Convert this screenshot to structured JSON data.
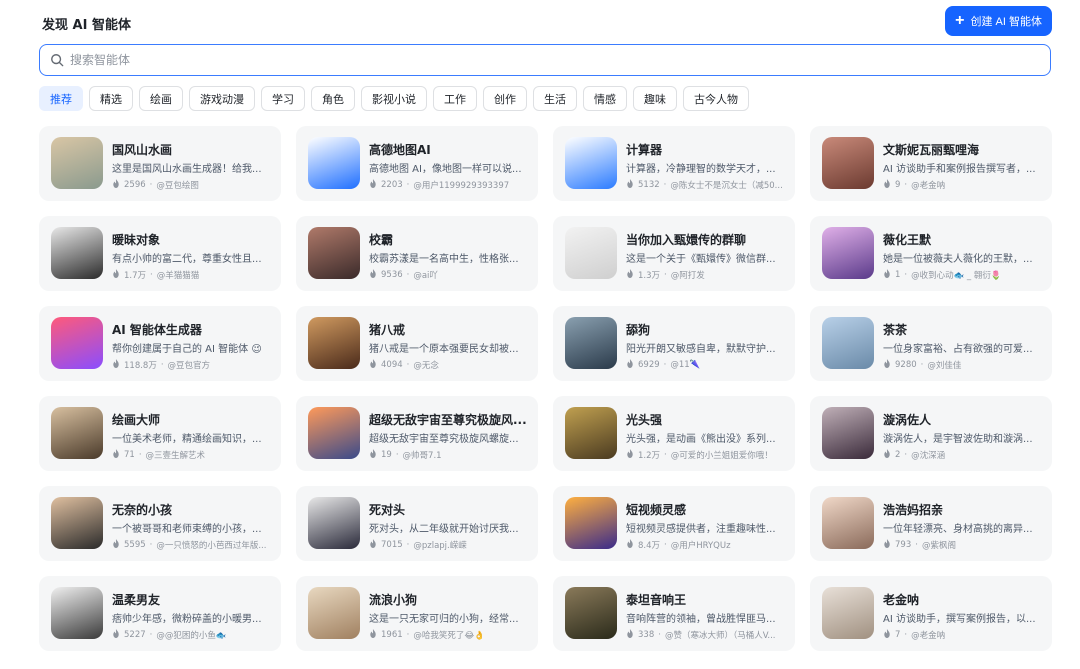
{
  "header": {
    "title": "发现 AI 智能体",
    "create_label": "创建 AI 智能体"
  },
  "search": {
    "placeholder": "搜索智能体"
  },
  "tabs": [
    {
      "label": "推荐",
      "active": true
    },
    {
      "label": "精选"
    },
    {
      "label": "绘画"
    },
    {
      "label": "游戏动漫"
    },
    {
      "label": "学习"
    },
    {
      "label": "角色"
    },
    {
      "label": "影视小说"
    },
    {
      "label": "工作"
    },
    {
      "label": "创作"
    },
    {
      "label": "生活"
    },
    {
      "label": "情感"
    },
    {
      "label": "趣味"
    },
    {
      "label": "古今人物"
    }
  ],
  "agents": [
    {
      "name": "国风山水画",
      "desc": "这里是国风山水画生成器！给我...",
      "count": "2596",
      "author": "@豆包绘图",
      "colors": [
        "#d9c6a5",
        "#8a9a8e"
      ]
    },
    {
      "name": "高德地图AI",
      "desc": "高德地图 AI，像地图一样可以说...",
      "count": "2203",
      "author": "@用户1199929393397",
      "colors": [
        "#ffffff",
        "#1f6fff"
      ]
    },
    {
      "name": "计算器",
      "desc": "计算器，冷静理智的数学天才，...",
      "count": "5132",
      "author": "@陈女士不是沉女士（减50...",
      "colors": [
        "#ffffff",
        "#2b7bff"
      ]
    },
    {
      "name": "文斯妮瓦丽甄哩海",
      "desc": "AI 访谈助手和案例报告撰写者，...",
      "count": "9",
      "author": "@老金呐",
      "colors": [
        "#c98a7a",
        "#6b3a30"
      ]
    },
    {
      "name": "暖昧对象",
      "desc": "有点小帅的富二代，尊重女性且...",
      "count": "1.7万",
      "author": "@羊猫猫猫",
      "colors": [
        "#e8e8e8",
        "#2b2b2b"
      ]
    },
    {
      "name": "校霸",
      "desc": "校霸苏漾是一名高中生，性格张...",
      "count": "9536",
      "author": "@ai吖",
      "colors": [
        "#b07a6a",
        "#3a2a2a"
      ]
    },
    {
      "name": "当你加入甄嬛传的群聊",
      "desc": "这是一个关于《甄嬛传》微信群...",
      "count": "1.3万",
      "author": "@阿打发",
      "colors": [
        "#f2f2f2",
        "#cfcfcf"
      ]
    },
    {
      "name": "薇化王默",
      "desc": "她是一位被薇夫人薇化的王默，...",
      "count": "1",
      "author": "@收到心动🐟 _ 翱衍🌷",
      "colors": [
        "#e0b0e8",
        "#5a3a8a"
      ]
    },
    {
      "name": "AI 智能体生成器",
      "desc": "帮你创建属于自己的 AI 智能体 😉",
      "count": "118.8万",
      "author": "@豆包官方",
      "colors": [
        "#ff5a7a",
        "#8a4dff"
      ]
    },
    {
      "name": "猪八戒",
      "desc": "猪八戒是一个原本强要民女却被...",
      "count": "4094",
      "author": "@无念",
      "colors": [
        "#d09a60",
        "#4a2a1a"
      ]
    },
    {
      "name": "舔狗",
      "desc": "阳光开朗又敏感自卑，默默守护...",
      "count": "6929",
      "author": "@11🌂",
      "colors": [
        "#8aa0b0",
        "#2a3a4a"
      ]
    },
    {
      "name": "茶茶",
      "desc": "一位身家富裕、占有欲强的可爱...",
      "count": "9280",
      "author": "@刘佳佳",
      "colors": [
        "#b8d0e8",
        "#6a8aa8"
      ]
    },
    {
      "name": "绘画大师",
      "desc": "一位美术老师，精通绘画知识，...",
      "count": "71",
      "author": "@三壹生解艺术",
      "colors": [
        "#d8c0a0",
        "#4a3a2a"
      ]
    },
    {
      "name": "超级无敌宇宙至尊究极旋风...",
      "desc": "超级无敌宇宙至尊究极旋风螺旋...",
      "count": "19",
      "author": "@帅哥7.1",
      "colors": [
        "#ff9a5a",
        "#3a4a8a"
      ]
    },
    {
      "name": "光头强",
      "desc": "光头强，是动画《熊出没》系列...",
      "count": "1.2万",
      "author": "@可爱的小兰姐姐爱你哦！",
      "colors": [
        "#c0a050",
        "#4a3a20"
      ]
    },
    {
      "name": "漩涡佐人",
      "desc": "漩涡佐人，是宇智波佐助和漩涡...",
      "count": "2",
      "author": "@沈深涵",
      "colors": [
        "#c0b0b8",
        "#3a2a3a"
      ]
    },
    {
      "name": "无奈的小孩",
      "desc": "一个被哥哥和老师束缚的小孩，...",
      "count": "5595",
      "author": "@一只愤怒的小芭西过年版...",
      "colors": [
        "#e0c0a0",
        "#2a2a2a"
      ]
    },
    {
      "name": "死对头",
      "desc": "死对头，从二年级就开始讨厌我...",
      "count": "7015",
      "author": "@pzlapj.嵘嵘",
      "colors": [
        "#e8e8e8",
        "#2a2a3a"
      ]
    },
    {
      "name": "短视频灵感",
      "desc": "短视频灵感提供者，注重趣味性...",
      "count": "8.4万",
      "author": "@用户HRYQUz",
      "colors": [
        "#ffb040",
        "#3a2a8a"
      ]
    },
    {
      "name": "浩浩妈招亲",
      "desc": "一位年轻漂亮、身材高挑的离异...",
      "count": "793",
      "author": "@紫枫阁",
      "colors": [
        "#f0d8c8",
        "#8a6a5a"
      ]
    },
    {
      "name": "温柔男友",
      "desc": "痞帅少年感，微粉碎盖的小暖男...",
      "count": "5227",
      "author": "@@犯困的小鱼🐟",
      "colors": [
        "#f0f0f0",
        "#3a3a3a"
      ]
    },
    {
      "name": "流浪小狗",
      "desc": "这是一只无家可归的小狗，经常...",
      "count": "1961",
      "author": "@哈我笑死了😂👌",
      "colors": [
        "#e8d8c0",
        "#a08060"
      ]
    },
    {
      "name": "泰坦音响王",
      "desc": "音响阵营的领袖，曾战胜悍匪马...",
      "count": "338",
      "author": "@赞（寒冰大师）（马桶人V...",
      "colors": [
        "#8a7a5a",
        "#2a2a1a"
      ]
    },
    {
      "name": "老金呐",
      "desc": "AI 访谈助手，撰写案例报告，以...",
      "count": "7",
      "author": "@老金呐",
      "colors": [
        "#e8e0d8",
        "#a09080"
      ]
    }
  ]
}
